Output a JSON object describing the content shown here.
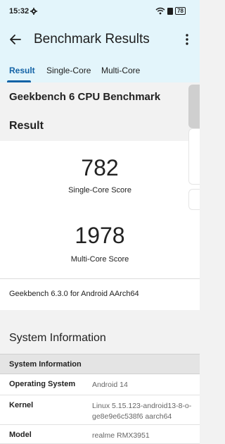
{
  "status_bar": {
    "time": "15:32",
    "battery": "78",
    "icons": [
      "gear-icon",
      "wifi-icon",
      "bluetooth-icon",
      "battery-icon"
    ]
  },
  "app_bar": {
    "title": "Benchmark Results",
    "icons": [
      "back-arrow-icon",
      "more-vert-icon"
    ]
  },
  "tabs": [
    {
      "label": "Result",
      "active": true
    },
    {
      "label": "Single-Core",
      "active": false
    },
    {
      "label": "Multi-Core",
      "active": false
    }
  ],
  "header": {
    "benchmark_title": "Geekbench 6 CPU Benchmark",
    "section_label": "Result"
  },
  "scores": {
    "single_core_value": "782",
    "single_core_label": "Single-Core Score",
    "multi_core_value": "1978",
    "multi_core_label": "Multi-Core Score"
  },
  "version": "Geekbench 6.3.0 for Android AArch64",
  "system_info": {
    "heading": "System Information",
    "table_header": "System Information",
    "rows": [
      {
        "key": "Operating System",
        "value": "Android 14"
      },
      {
        "key": "Kernel",
        "value": "Linux 5.15.123-android13-8-o-ge8e9e6c538f6 aarch64"
      },
      {
        "key": "Model",
        "value": "realme RMX3951"
      }
    ]
  },
  "colors": {
    "accent": "#1463a6",
    "header_bg": "#e3f5fb"
  }
}
